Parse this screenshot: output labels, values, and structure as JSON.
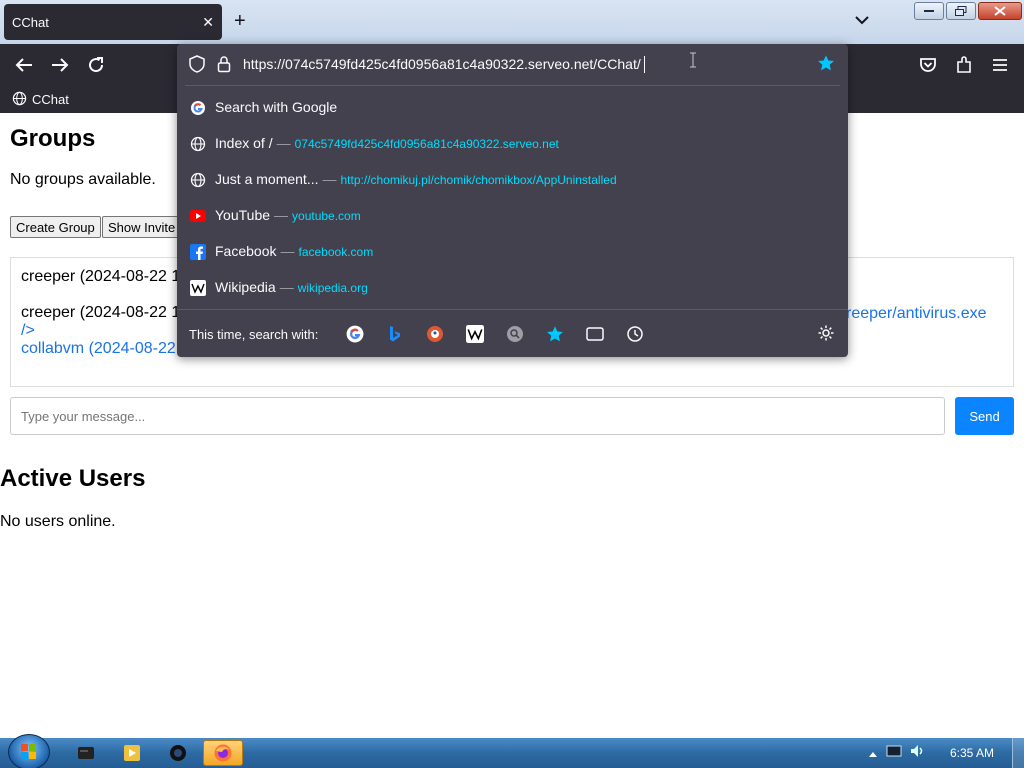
{
  "browser": {
    "tab_title": "CChat",
    "tab_close": "✕",
    "new_tab": "+",
    "bookmark_label": "CChat",
    "url": "https://074c5749fd425c4fd0956a81c4a90322.serveo.net/CChat/",
    "suggestions": [
      {
        "title": "Search with Google",
        "url": "",
        "icon": "google-icon"
      },
      {
        "title": "Index of /",
        "url": "074c5749fd425c4fd0956a81c4a90322.serveo.net",
        "icon": "globe-icon"
      },
      {
        "title": "Just a moment...",
        "url": "http://chomikuj.pl/chomik/chomikbox/AppUninstalled",
        "icon": "globe-icon"
      },
      {
        "title": "YouTube",
        "url": "youtube.com",
        "icon": "youtube-icon"
      },
      {
        "title": "Facebook",
        "url": "facebook.com",
        "icon": "facebook-icon"
      },
      {
        "title": "Wikipedia",
        "url": "wikipedia.org",
        "icon": "wikipedia-icon"
      }
    ],
    "dash": "—",
    "search_with_label": "This time, search with:"
  },
  "page": {
    "groups_title": "Groups",
    "groups_empty": "No groups available.",
    "create_group": "Create Group",
    "show_invites": "Show Invite",
    "messages": [
      {
        "text": "creeper (2024-08-22 1"
      },
      {
        "text": "creeper (2024-08-22 1"
      },
      {
        "text": "/>"
      },
      {
        "text": "collabvm (2024-08-22"
      }
    ],
    "message_right": "reeper/antivirus.exe",
    "input_placeholder": "Type your message...",
    "send": "Send",
    "users_title": "Active Users",
    "users_empty": "No users online."
  },
  "taskbar": {
    "clock": "6:35 AM"
  },
  "colors": {
    "chrome_dark": "#2b2a33",
    "dropdown_bg": "#42414d",
    "url_accent": "#00ddff",
    "send_blue": "#0a84ff",
    "link_blue": "#1a73e8"
  }
}
